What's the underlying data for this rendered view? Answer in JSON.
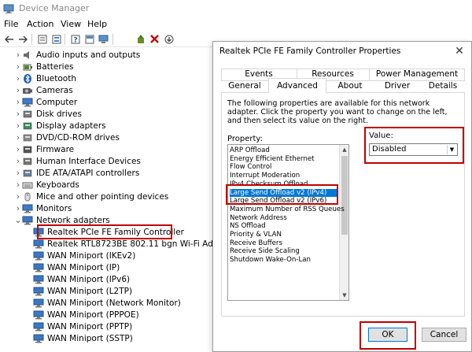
{
  "device_manager": {
    "title": "Device Manager",
    "menu": [
      "File",
      "Action",
      "View",
      "Help"
    ],
    "toolbar_icons": [
      "back-arrow-icon",
      "forward-arrow-icon",
      "properties-icon",
      "list-icon",
      "help-icon",
      "computer-icon",
      "update-driver-icon",
      "uninstall-icon",
      "scan-hardware-icon"
    ],
    "tree": [
      {
        "label": "Audio inputs and outputs",
        "icon": "speaker-icon",
        "expanded": false,
        "level": 1
      },
      {
        "label": "Batteries",
        "icon": "battery-icon",
        "expanded": false,
        "level": 1
      },
      {
        "label": "Bluetooth",
        "icon": "bluetooth-icon",
        "expanded": false,
        "level": 1
      },
      {
        "label": "Cameras",
        "icon": "camera-icon",
        "expanded": false,
        "level": 1
      },
      {
        "label": "Computer",
        "icon": "monitor-icon",
        "expanded": false,
        "level": 1
      },
      {
        "label": "Disk drives",
        "icon": "disk-icon",
        "expanded": false,
        "level": 1
      },
      {
        "label": "Display adapters",
        "icon": "display-adapter-icon",
        "expanded": false,
        "level": 1
      },
      {
        "label": "DVD/CD-ROM drives",
        "icon": "dvd-icon",
        "expanded": false,
        "level": 1
      },
      {
        "label": "Firmware",
        "icon": "chip-icon",
        "expanded": false,
        "level": 1
      },
      {
        "label": "Human Interface Devices",
        "icon": "hid-icon",
        "expanded": false,
        "level": 1
      },
      {
        "label": "IDE ATA/ATAPI controllers",
        "icon": "controller-icon",
        "expanded": false,
        "level": 1
      },
      {
        "label": "Keyboards",
        "icon": "keyboard-icon",
        "expanded": false,
        "level": 1
      },
      {
        "label": "Mice and other pointing devices",
        "icon": "mouse-icon",
        "expanded": false,
        "level": 1
      },
      {
        "label": "Monitors",
        "icon": "monitor-icon",
        "expanded": false,
        "level": 1
      },
      {
        "label": "Network adapters",
        "icon": "network-icon",
        "expanded": true,
        "level": 1
      },
      {
        "label": "Realtek PCIe FE Family Controller",
        "icon": "network-adapter-icon",
        "level": 2,
        "highlighted": true
      },
      {
        "label": "Realtek RTL8723BE 802.11 bgn Wi-Fi Adapter",
        "icon": "network-adapter-icon",
        "level": 2
      },
      {
        "label": "WAN Miniport (IKEv2)",
        "icon": "network-adapter-icon",
        "level": 2
      },
      {
        "label": "WAN Miniport (IP)",
        "icon": "network-adapter-icon",
        "level": 2
      },
      {
        "label": "WAN Miniport (IPv6)",
        "icon": "network-adapter-icon",
        "level": 2
      },
      {
        "label": "WAN Miniport (L2TP)",
        "icon": "network-adapter-icon",
        "level": 2
      },
      {
        "label": "WAN Miniport (Network Monitor)",
        "icon": "network-adapter-icon",
        "level": 2
      },
      {
        "label": "WAN Miniport (PPPOE)",
        "icon": "network-adapter-icon",
        "level": 2
      },
      {
        "label": "WAN Miniport (PPTP)",
        "icon": "network-adapter-icon",
        "level": 2
      },
      {
        "label": "WAN Miniport (SSTP)",
        "icon": "network-adapter-icon",
        "level": 2
      }
    ]
  },
  "dialog": {
    "title": "Realtek PCIe FE Family Controller Properties",
    "tabs_row1": [
      "Events",
      "Resources",
      "Power Management"
    ],
    "tabs_row2": [
      "General",
      "Advanced",
      "About",
      "Driver",
      "Details"
    ],
    "active_tab": "Advanced",
    "description": "The following properties are available for this network adapter. Click the property you want to change on the left, and then select its value on the right.",
    "property_label": "Property:",
    "properties": [
      "ARP Offload",
      "Energy Efficient Ethernet",
      "Flow Control",
      "Interrupt Moderation",
      "IPv4 Checksum Offload",
      "Large Send Offload v2 (IPv4)",
      "Large Send Offload v2 (IPv6)",
      "Maximum Number of RSS Queues",
      "Network Address",
      "NS Offload",
      "Priority & VLAN",
      "Receive Buffers",
      "Receive Side Scaling",
      "Shutdown Wake-On-Lan"
    ],
    "selected_property": "Large Send Offload v2 (IPv4)",
    "value_label": "Value:",
    "value_selected": "Disabled",
    "ok_label": "OK",
    "cancel_label": "Cancel",
    "highlight_color": "#c00000",
    "selection_color": "#0078d7"
  }
}
